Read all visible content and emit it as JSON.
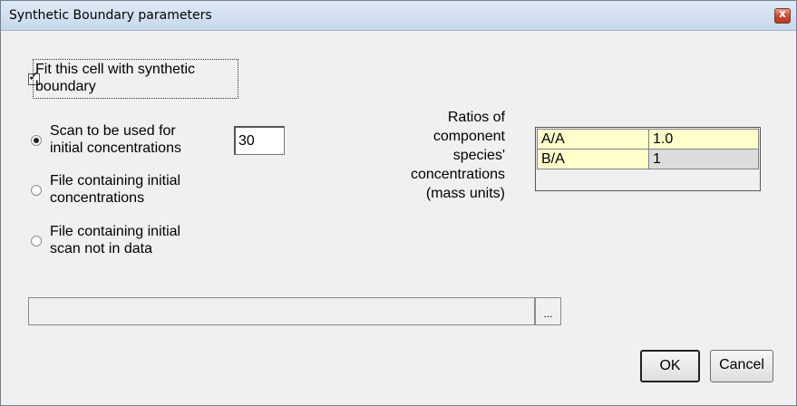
{
  "window": {
    "title": "Synthetic Boundary parameters",
    "close_glyph": "x"
  },
  "fit_checkbox": {
    "label_line1": "Fit this cell with synthetic",
    "label_line2": "boundary",
    "checked": true,
    "check_glyph": "✓"
  },
  "options": [
    {
      "line1": "Scan to be used for",
      "line2": "initial concentrations",
      "selected": true
    },
    {
      "line1": "File containing initial",
      "line2": "concentrations",
      "selected": false
    },
    {
      "line1": "File containing initial",
      "line2": "scan not in data",
      "selected": false
    }
  ],
  "scan_input": {
    "value": "30"
  },
  "ratios_label": {
    "line1": "Ratios of",
    "line2": "component",
    "line3": "species'",
    "line4": "concentrations",
    "line5": "(mass units)"
  },
  "ratios_table": {
    "rows": [
      {
        "name": "A/A",
        "value": "1.0"
      },
      {
        "name": "B/A",
        "value": "1"
      }
    ]
  },
  "path_field": {
    "value": "",
    "browse_label": "..."
  },
  "buttons": {
    "ok": "OK",
    "cancel": "Cancel"
  },
  "colors": {
    "cell_editable": "#ffffcc",
    "cell_readonly": "#dcdcdc"
  }
}
